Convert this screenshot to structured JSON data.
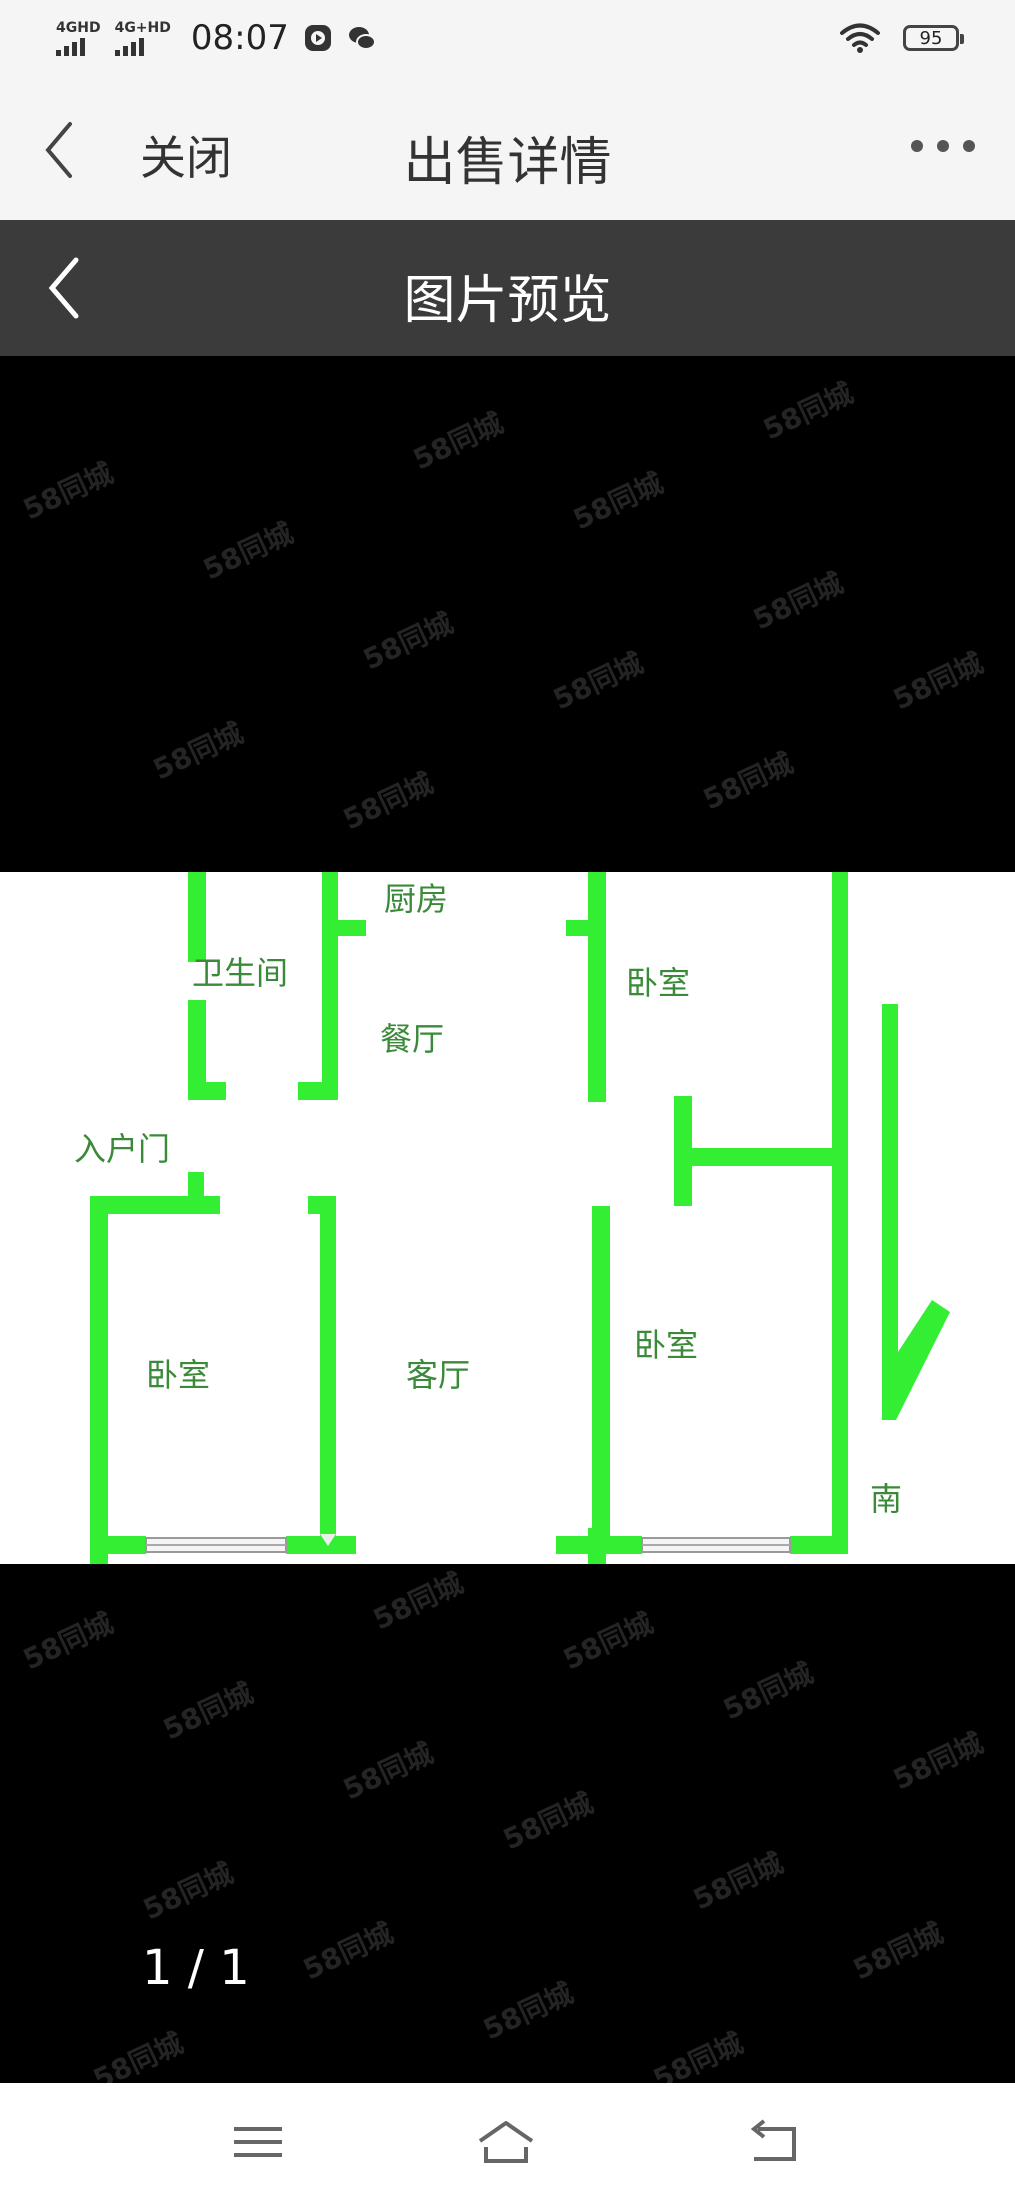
{
  "status_bar": {
    "time": "08:07",
    "sim1": "4GHD",
    "sim2": "4G+HD",
    "battery": "95"
  },
  "header": {
    "close_label": "关闭",
    "title": "出售详情"
  },
  "preview": {
    "title": "图片预览",
    "counter": "1 / 1"
  },
  "watermark": "58同城",
  "floorplan": {
    "kitchen": "厨房",
    "bathroom": "卫生间",
    "dining": "餐厅",
    "bedroom_top_right": "卧室",
    "entrance": "入户门",
    "bedroom_left": "卧室",
    "living_room": "客厅",
    "bedroom_right": "卧室",
    "south": "南"
  },
  "colors": {
    "wall": "#33ee33",
    "text": "#3a8a3a"
  }
}
